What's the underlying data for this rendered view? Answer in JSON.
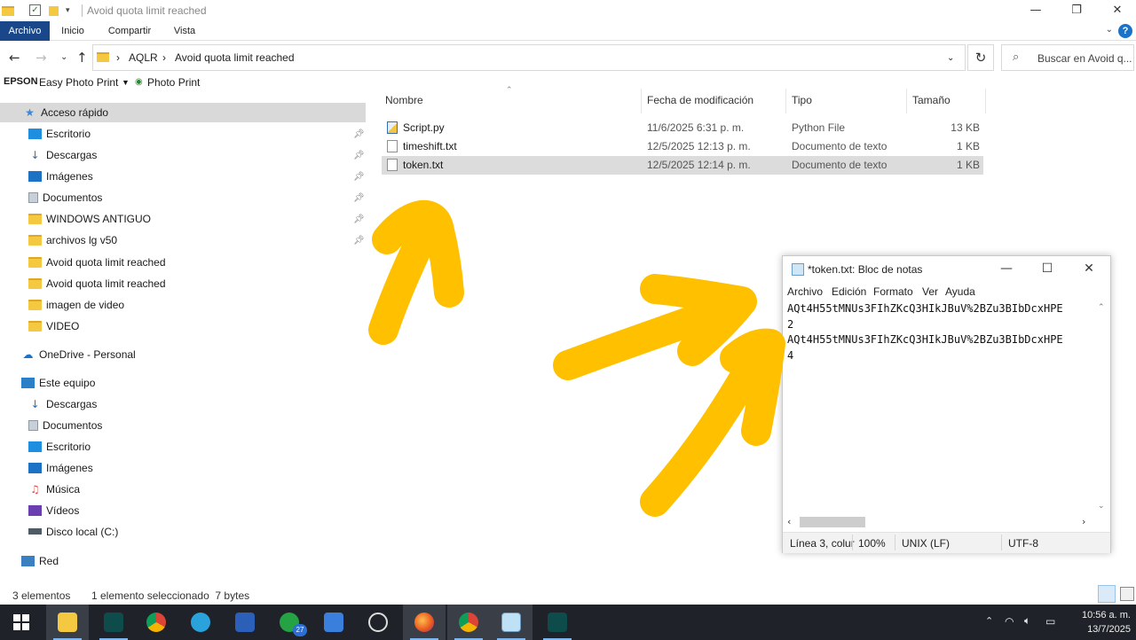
{
  "window": {
    "title": "Avoid quota limit reached",
    "controls": {
      "minimize": "—",
      "maximize": "❐",
      "close": "✕"
    }
  },
  "ribbon": {
    "tabs": [
      "Archivo",
      "Inicio",
      "Compartir",
      "Vista"
    ],
    "active_tab": "Archivo",
    "help_label": "?"
  },
  "address": {
    "breadcrumb": [
      "AQLR",
      "Avoid quota limit reached"
    ],
    "search_placeholder": "Buscar en Avoid q..."
  },
  "epson_toolbar": {
    "brand": "EPSON",
    "easy_photo_print": "Easy Photo Print",
    "photo_print": "Photo Print"
  },
  "nav_pane": {
    "quick_access": "Acceso rápido",
    "quick_items": [
      {
        "label": "Escritorio",
        "icon": "desktop-icon",
        "pinned": true
      },
      {
        "label": "Descargas",
        "icon": "download-icon",
        "pinned": true
      },
      {
        "label": "Imágenes",
        "icon": "images-icon",
        "pinned": true
      },
      {
        "label": "Documentos",
        "icon": "documents-icon",
        "pinned": true
      },
      {
        "label": "WINDOWS ANTIGUO",
        "icon": "folder-icon",
        "pinned": true
      },
      {
        "label": "archivos lg v50",
        "icon": "folder-icon",
        "pinned": true
      },
      {
        "label": "Avoid quota limit reached",
        "icon": "folder-icon",
        "pinned": false
      },
      {
        "label": "Avoid quota limit reached",
        "icon": "folder-icon",
        "pinned": false
      },
      {
        "label": "imagen de video",
        "icon": "folder-icon",
        "pinned": false
      },
      {
        "label": "VIDEO",
        "icon": "folder-icon",
        "pinned": false
      }
    ],
    "onedrive": "OneDrive - Personal",
    "this_pc": "Este equipo",
    "pc_items": [
      {
        "label": "Descargas",
        "icon": "download-icon"
      },
      {
        "label": "Documentos",
        "icon": "documents-icon"
      },
      {
        "label": "Escritorio",
        "icon": "desktop-icon"
      },
      {
        "label": "Imágenes",
        "icon": "images-icon"
      },
      {
        "label": "Música",
        "icon": "music-icon"
      },
      {
        "label": "Vídeos",
        "icon": "videos-icon"
      },
      {
        "label": "Disco local (C:)",
        "icon": "drive-icon"
      }
    ],
    "network": "Red"
  },
  "file_list": {
    "columns": [
      "Nombre",
      "Fecha de modificación",
      "Tipo",
      "Tamaño"
    ],
    "files": [
      {
        "name": "Script.py",
        "date": "11/6/2025 6:31 p. m.",
        "type": "Python File",
        "size": "13 KB",
        "icon": "python-file-icon",
        "selected": false
      },
      {
        "name": "timeshift.txt",
        "date": "12/5/2025 12:13 p. m.",
        "type": "Documento de texto",
        "size": "1 KB",
        "icon": "text-file-icon",
        "selected": false
      },
      {
        "name": "token.txt",
        "date": "12/5/2025 12:14 p. m.",
        "type": "Documento de texto",
        "size": "1 KB",
        "icon": "text-file-icon",
        "selected": true
      }
    ]
  },
  "status_bar": {
    "count": "3 elementos",
    "selection": "1 elemento seleccionado  7 bytes"
  },
  "notepad": {
    "title": "*token.txt: Bloc de notas",
    "menu": [
      "Archivo",
      "Edición",
      "Formato",
      "Ver",
      "Ayuda"
    ],
    "lines": [
      "AQt4H55tMNUs3FIhZKcQ3HIkJBuV%2BZu3BIbDcxHPE",
      "2",
      "AQt4H55tMNUs3FIhZKcQ3HIkJBuV%2BZu3BIbDcxHPE",
      "4"
    ],
    "status": {
      "position": "Línea 3, colur",
      "zoom": "100%",
      "eol": "UNIX (LF)",
      "encoding": "UTF-8"
    }
  },
  "taskbar": {
    "apps": [
      "start",
      "file-explorer",
      "filmora",
      "chrome",
      "telegram",
      "word",
      "whatsapp",
      "microsoft-store",
      "chatgpt",
      "firefox",
      "chrome-profile",
      "notepad",
      "filmora-2"
    ],
    "whatsapp_badge": "27",
    "time": "10:56 a. m.",
    "date": "13/7/2025"
  },
  "colors": {
    "ribbon_active": "#19478a",
    "arrow": "#ffc000",
    "taskbar": "#1f2329",
    "selection": "#dcdcdc"
  }
}
